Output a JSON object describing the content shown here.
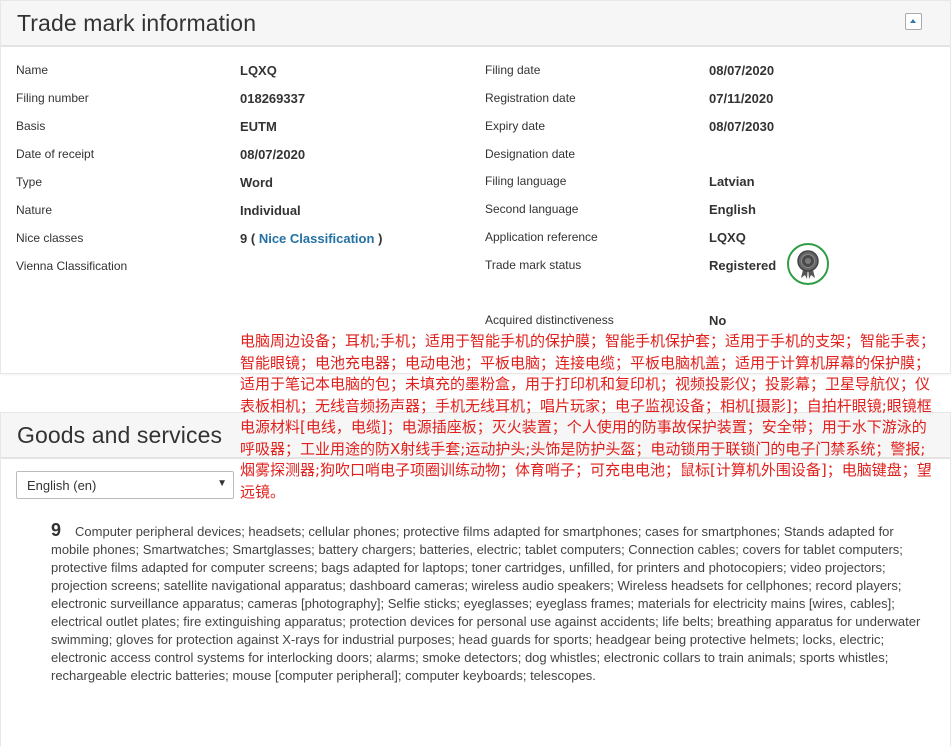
{
  "trademark_panel": {
    "title": "Trade mark information",
    "left_fields": [
      {
        "label": "Name",
        "value": "LQXQ"
      },
      {
        "label": "Filing number",
        "value": "018269337"
      },
      {
        "label": "Basis",
        "value": "EUTM"
      },
      {
        "label": "Date of receipt",
        "value": "08/07/2020"
      },
      {
        "label": "Type",
        "value": "Word"
      },
      {
        "label": "Nature",
        "value": "Individual"
      },
      {
        "label": "Nice classes",
        "value_number": "9",
        "open_paren": "(",
        "link_text": "Nice Classification",
        "close_paren": ")"
      },
      {
        "label": "Vienna Classification",
        "value": ""
      }
    ],
    "right_fields": [
      {
        "label": "Filing date",
        "value": "08/07/2020"
      },
      {
        "label": "Registration date",
        "value": "07/11/2020"
      },
      {
        "label": "Expiry date",
        "value": "08/07/2030"
      },
      {
        "label": "Designation date",
        "value": ""
      },
      {
        "label": "Filing language",
        "value": "Latvian"
      },
      {
        "label": "Second language",
        "value": "English"
      },
      {
        "label": "Application reference",
        "value": "LQXQ"
      },
      {
        "label": "Trade mark status",
        "value": "Registered"
      },
      {
        "label": "Acquired distinctiveness",
        "value": "No"
      }
    ],
    "status_icon": "registered-seal-icon",
    "status_color": "#2f9e44"
  },
  "chinese_overlay": {
    "text": "电脑周边设备；耳机;手机；适用于智能手机的保护膜；智能手机保护套；适用于手机的支架；智能手表；智能眼镜；电池充电器；电动电池；平板电脑；连接电缆；平板电脑机盖；适用于计算机屏幕的保护膜；适用于笔记本电脑的包；未填充的墨粉盒，用于打印机和复印机；视频投影仪；投影幕；卫星导航仪；仪表板相机；无线音频扬声器；手机无线耳机；唱片玩家；电子监视设备；相机[摄影]；自拍杆眼镜;眼镜框电源材料[电线，电缆]；电源插座板；灭火装置；个人使用的防事故保护装置；安全带；用于水下游泳的呼吸器；工业用途的防X射线手套;运动护头;头饰是防护头盔；电动锁用于联锁门的电子门禁系统；警报;烟雾探测器;狗吹口哨电子项圈训练动物；体育哨子；可充电电池；鼠标[计算机外围设备]；电脑键盘；望远镜。",
    "color": "#e0201c"
  },
  "goods_panel": {
    "title": "Goods and services",
    "language_select": {
      "selected": "English (en)",
      "arrow": "▼"
    },
    "class_number": "9",
    "description": "Computer peripheral devices; headsets; cellular phones; protective films adapted for smartphones; cases for smartphones; Stands adapted for mobile phones; Smartwatches; Smartglasses; battery chargers; batteries, electric; tablet computers; Connection cables; covers for tablet computers; protective films adapted for computer screens; bags adapted for laptops; toner cartridges, unfilled, for printers and photocopiers; video projectors; projection screens; satellite navigational apparatus; dashboard cameras; wireless audio speakers; Wireless headsets for cellphones; record players; electronic surveillance apparatus; cameras [photography]; Selfie sticks; eyeglasses; eyeglass frames; materials for electricity mains [wires, cables]; electrical outlet plates; fire extinguishing apparatus; protection devices for personal use against accidents; life belts; breathing apparatus for underwater swimming; gloves for protection against X-rays for industrial purposes; head guards for sports; headgear being protective helmets; locks, electric; electronic access control systems for interlocking doors; alarms; smoke detectors; dog whistles; electronic collars to train animals; sports whistles; rechargeable electric batteries; mouse [computer peripheral]; computer keyboards; telescopes."
  },
  "colors": {
    "link": "#2472a4",
    "header_bg": "#f6f6f6"
  }
}
